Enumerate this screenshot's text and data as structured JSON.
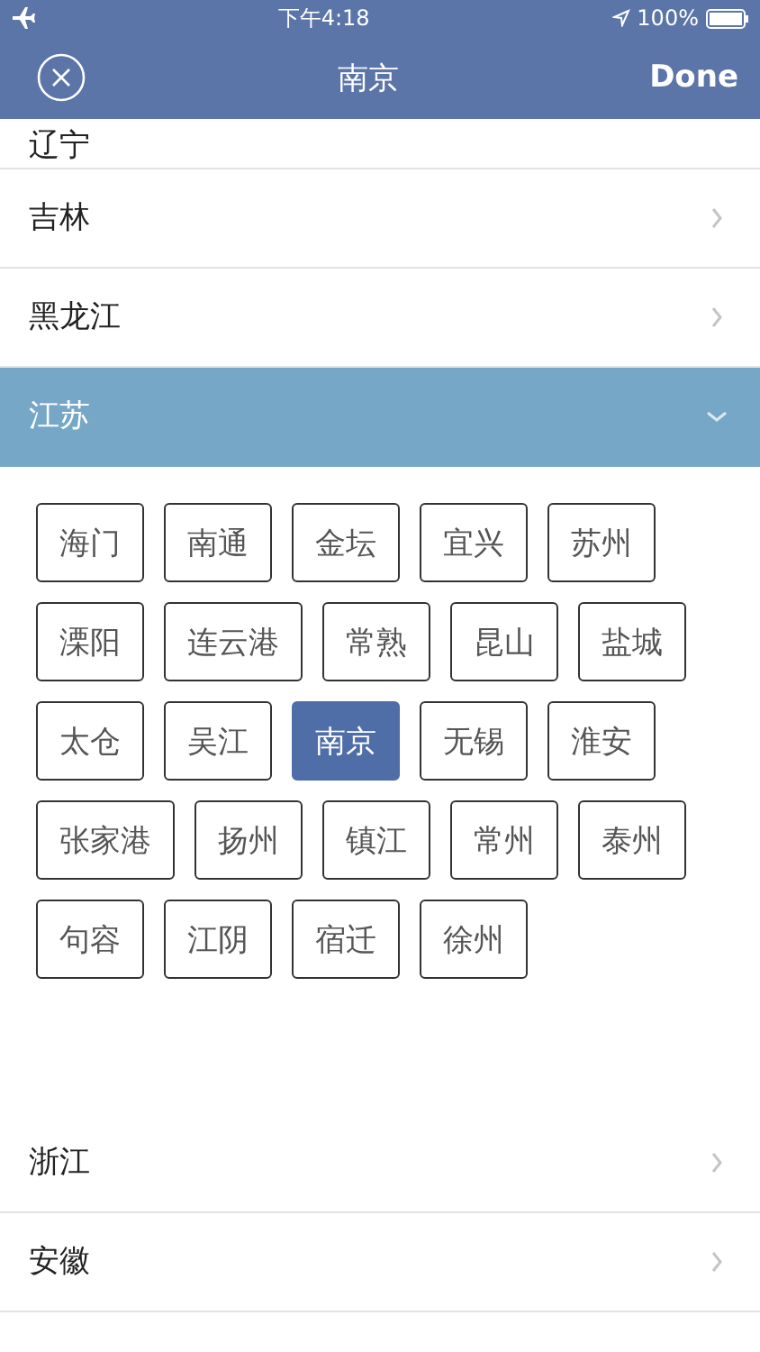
{
  "status_bar": {
    "time": "下午4:18",
    "battery": "100%"
  },
  "nav": {
    "title": "南京",
    "done": "Done"
  },
  "provinces": [
    {
      "name": "辽宁",
      "expanded": false
    },
    {
      "name": "吉林",
      "expanded": false
    },
    {
      "name": "黑龙江",
      "expanded": false
    },
    {
      "name": "江苏",
      "expanded": true,
      "cities": [
        {
          "name": "海门",
          "selected": false
        },
        {
          "name": "南通",
          "selected": false
        },
        {
          "name": "金坛",
          "selected": false
        },
        {
          "name": "宜兴",
          "selected": false
        },
        {
          "name": "苏州",
          "selected": false
        },
        {
          "name": "溧阳",
          "selected": false
        },
        {
          "name": "连云港",
          "selected": false
        },
        {
          "name": "常熟",
          "selected": false
        },
        {
          "name": "昆山",
          "selected": false
        },
        {
          "name": "盐城",
          "selected": false
        },
        {
          "name": "太仓",
          "selected": false
        },
        {
          "name": "吴江",
          "selected": false
        },
        {
          "name": "南京",
          "selected": true
        },
        {
          "name": "无锡",
          "selected": false
        },
        {
          "name": "淮安",
          "selected": false
        },
        {
          "name": "张家港",
          "selected": false
        },
        {
          "name": "扬州",
          "selected": false
        },
        {
          "name": "镇江",
          "selected": false
        },
        {
          "name": "常州",
          "selected": false
        },
        {
          "name": "泰州",
          "selected": false
        },
        {
          "name": "句容",
          "selected": false
        },
        {
          "name": "江阴",
          "selected": false
        },
        {
          "name": "宿迁",
          "selected": false
        },
        {
          "name": "徐州",
          "selected": false
        }
      ]
    },
    {
      "name": "浙江",
      "expanded": false
    },
    {
      "name": "安徽",
      "expanded": false
    }
  ]
}
